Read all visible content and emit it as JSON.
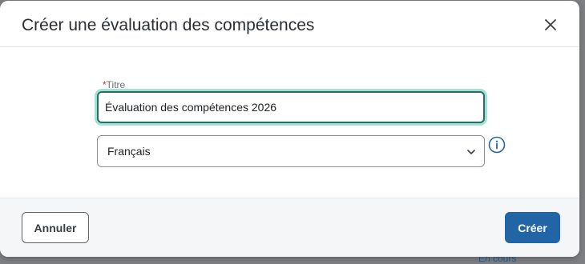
{
  "background": {
    "status_peek": "En cours"
  },
  "dialog": {
    "title": "Créer une évaluation des compétences",
    "close_icon": "close-icon"
  },
  "form": {
    "title_label": "Titre",
    "title_required_mark": "*",
    "title_value": "Évaluation des compétences 2026",
    "language_value": "Français",
    "chevron_icon": "chevron-down-icon",
    "info_icon": "info-icon"
  },
  "footer": {
    "cancel_label": "Annuler",
    "create_label": "Créer"
  },
  "colors": {
    "primary": "#2265a6",
    "focus_ring": "#9fe3d3",
    "required": "#d0342c"
  }
}
